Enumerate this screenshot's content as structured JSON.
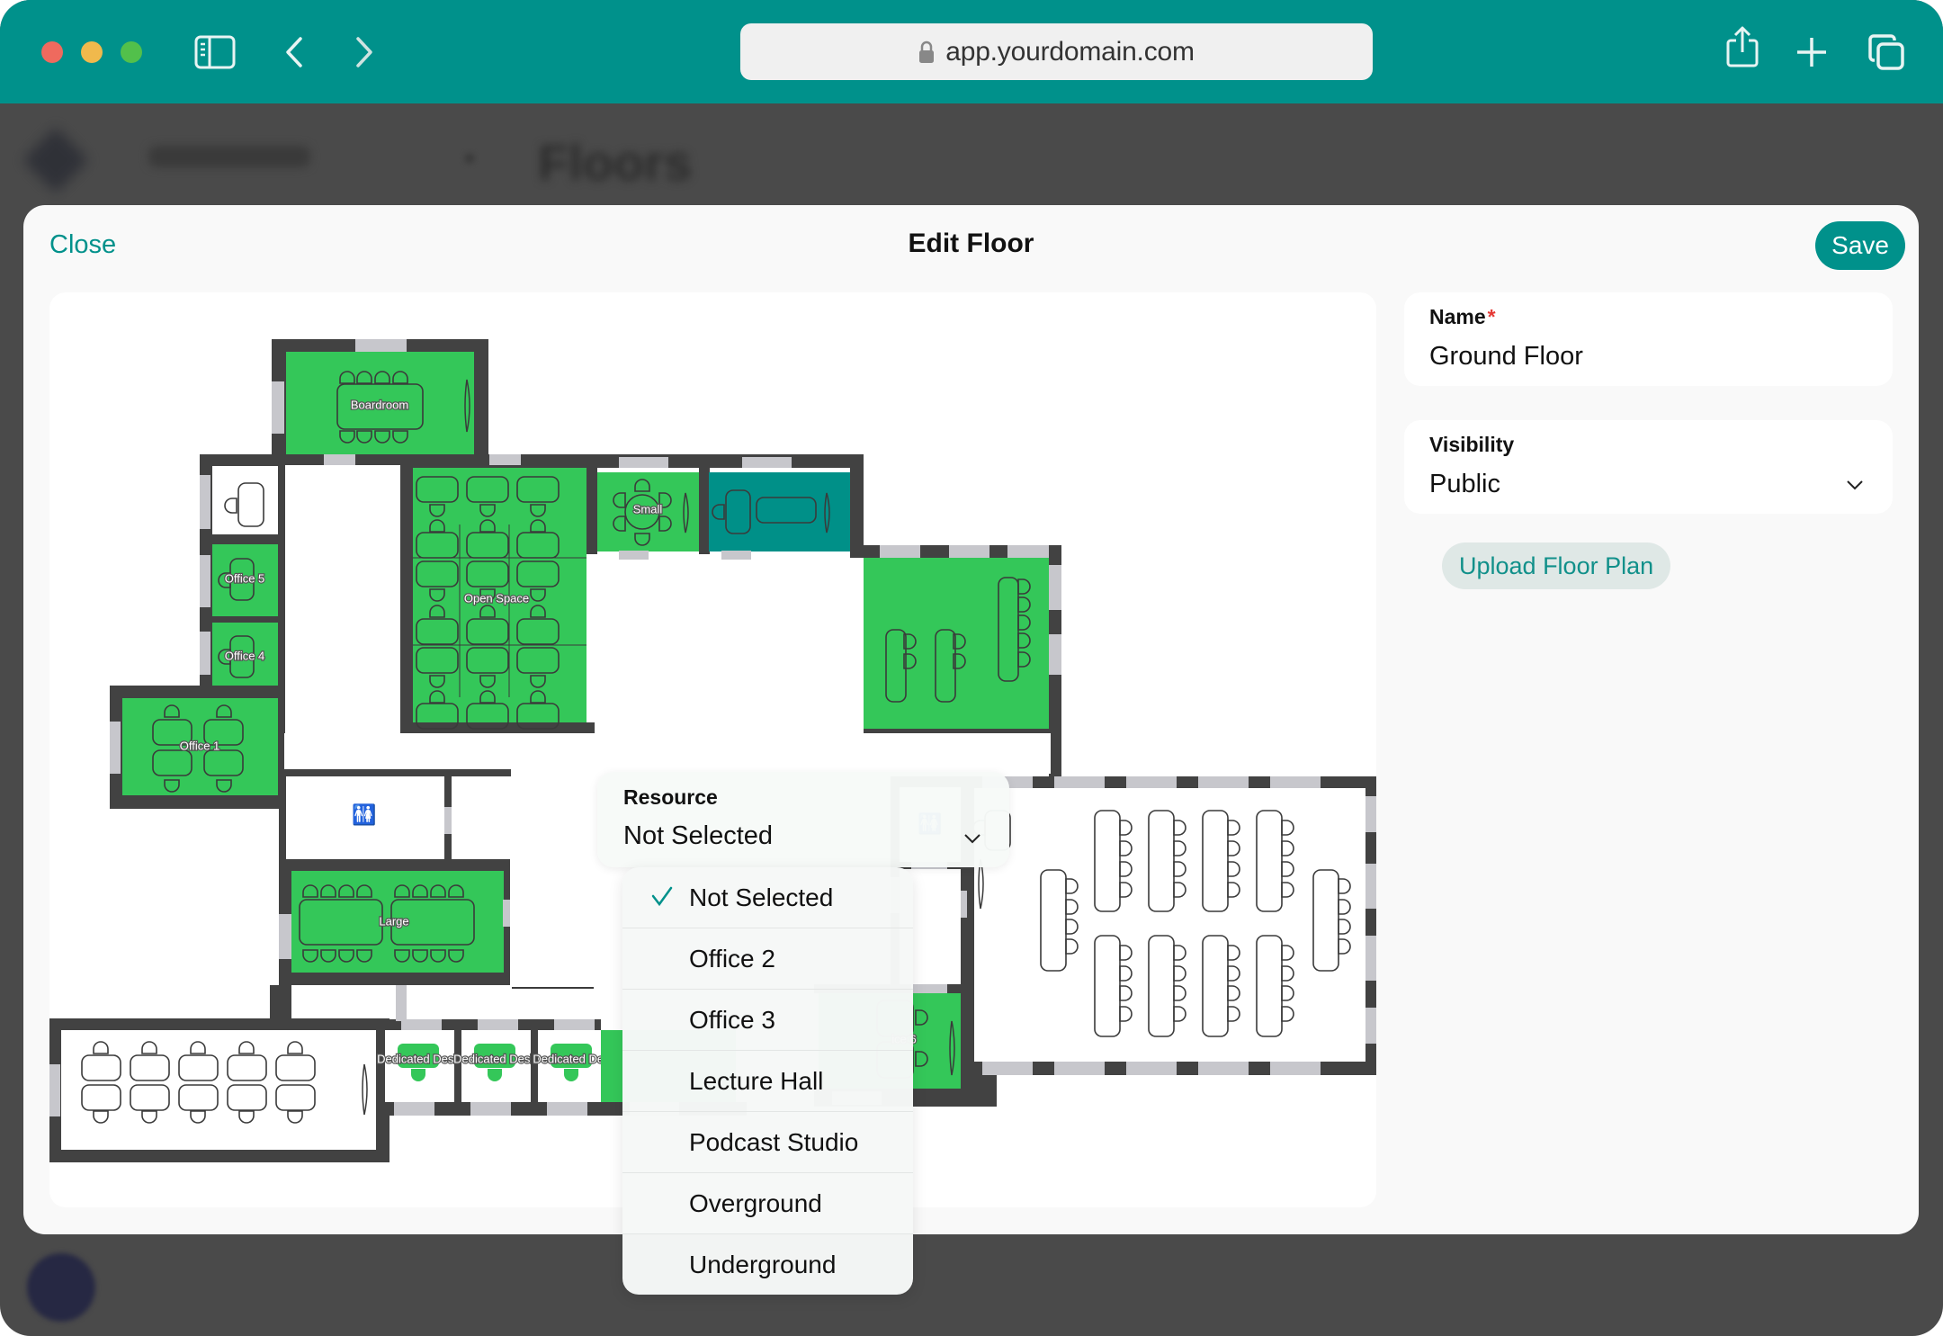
{
  "browser": {
    "url": "app.yourdomain.com",
    "icons": [
      "sidebar-toggle-icon",
      "back-icon",
      "forward-icon",
      "lock-icon",
      "share-icon",
      "new-tab-icon",
      "tabs-overview-icon"
    ]
  },
  "background_app": {
    "page_title": "Floors"
  },
  "modal": {
    "close_label": "Close",
    "title": "Edit Floor",
    "save_label": "Save"
  },
  "form": {
    "name": {
      "label": "Name",
      "required_marker": "*",
      "value": "Ground Floor"
    },
    "visibility": {
      "label": "Visibility",
      "value": "Public"
    },
    "upload_label": "Upload Floor Plan"
  },
  "resource_picker": {
    "label": "Resource",
    "value": "Not Selected",
    "options": [
      {
        "label": "Not Selected",
        "selected": true
      },
      {
        "label": "Office 2",
        "selected": false
      },
      {
        "label": "Office 3",
        "selected": false
      },
      {
        "label": "Lecture Hall",
        "selected": false
      },
      {
        "label": "Podcast Studio",
        "selected": false
      },
      {
        "label": "Overground",
        "selected": false
      },
      {
        "label": "Underground",
        "selected": false
      }
    ]
  },
  "floor_plan": {
    "room_labels": {
      "boardroom": "Boardroom",
      "small": "Small",
      "open_space": "Open Space",
      "office_5": "Office 5",
      "office_4": "Office 4",
      "office_1": "Office 1",
      "large": "Large",
      "dedicated_desk_1": "Dedicated Desk",
      "dedicated_desk_2": "Dedicated Desk",
      "dedicated_desk_3": "Dedicated Des",
      "office_6": "ice 6"
    },
    "colors": {
      "bookable": "#34c759",
      "selected": "#009088",
      "wall": "#424242",
      "window": "#c7c7cc"
    }
  },
  "theme": {
    "accent": "#00918b",
    "overlay": "#4a4a4a"
  }
}
